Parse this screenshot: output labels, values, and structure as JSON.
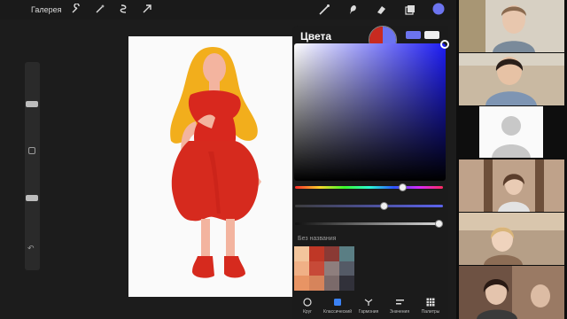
{
  "app": {
    "gallery_label": "Галерея",
    "toolbar_left_icons": [
      "wrench-icon",
      "magic-wand-icon",
      "selection-icon",
      "transform-arrow-icon"
    ],
    "toolbar_right_icons": [
      "brush-icon",
      "smudge-icon",
      "eraser-icon",
      "layers-icon",
      "color-swatch-icon"
    ],
    "active_color": "#6c74ef"
  },
  "color_panel": {
    "title": "Цвета",
    "current_color": "#c82a20",
    "previous_color": "#6c74ef",
    "history_colors": [
      "#6c74ef",
      "#f0f0f0"
    ],
    "field_hue_color": "#1d1cf4",
    "hue_level": 0.73,
    "saturation_level": 0.6,
    "value_level": 0.99,
    "palette_name": "Без названия",
    "palette_colors": [
      "#f3c59c",
      "#bf3726",
      "#8a3a35",
      "#5a7e84",
      "#f0b086",
      "#c74a38",
      "#8e7e7d",
      "#545a66",
      "#e89464",
      "#d6845b",
      "#7b6a6a",
      "#31313a"
    ],
    "tabs": [
      {
        "label": "Круг",
        "icon": "disc-icon"
      },
      {
        "label": "Классический",
        "icon": "classic-square-icon"
      },
      {
        "label": "Гармония",
        "icon": "harmony-icon"
      },
      {
        "label": "Значения",
        "icon": "value-sliders-icon"
      },
      {
        "label": "Палитры",
        "icon": "palettes-grid-icon"
      }
    ],
    "active_tab": "Классический"
  },
  "participants": [
    {
      "kind": "video",
      "tile_name": "participant-tile-1"
    },
    {
      "kind": "video",
      "tile_name": "participant-tile-2"
    },
    {
      "kind": "avatar",
      "tile_name": "participant-tile-3"
    },
    {
      "kind": "video",
      "tile_name": "participant-tile-4"
    },
    {
      "kind": "video",
      "tile_name": "participant-tile-5"
    },
    {
      "kind": "video",
      "tile_name": "participant-tile-6"
    }
  ]
}
